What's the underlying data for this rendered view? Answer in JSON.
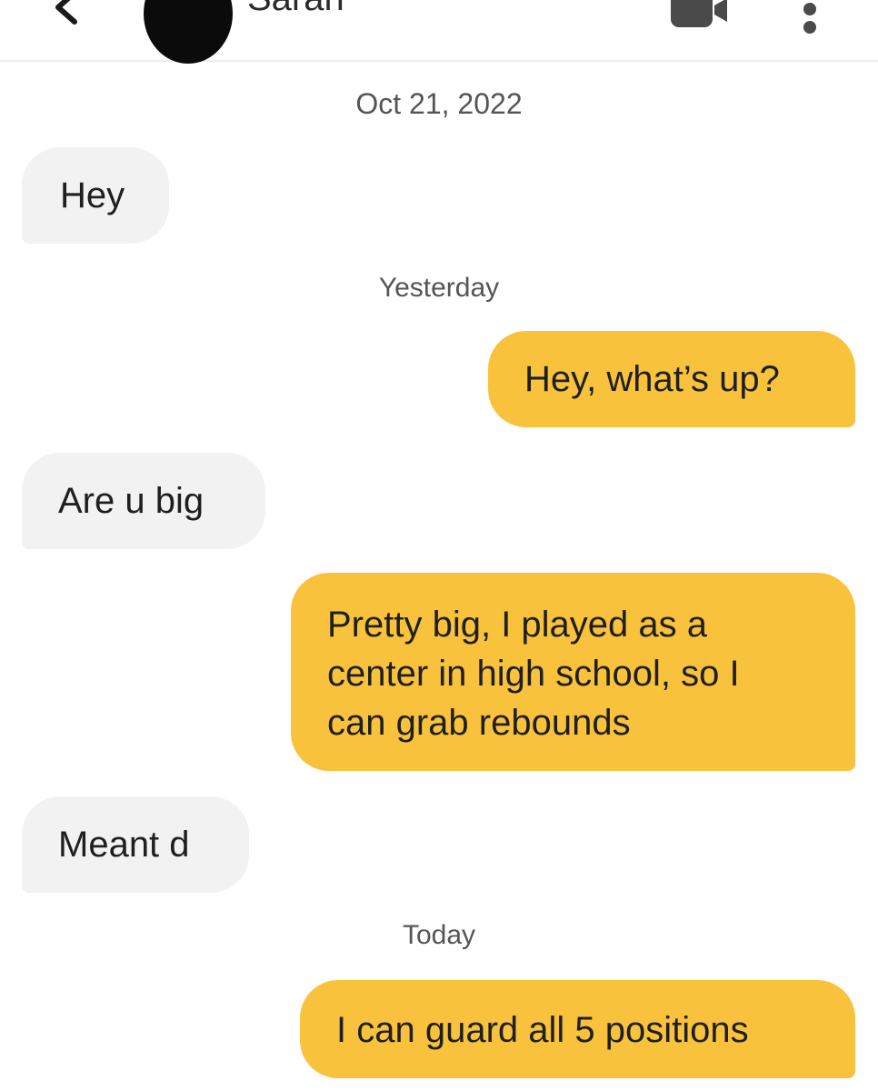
{
  "header": {
    "contact_name": "Sarah",
    "back_icon": "chevron-left-icon",
    "video_icon": "video-camera-icon",
    "more_icon": "more-vertical-icon"
  },
  "colors": {
    "outgoing_bubble": "#f9c23c",
    "incoming_bubble": "#f2f2f2",
    "timestamp_text": "#555555"
  },
  "conversation": {
    "date_1": "Oct 21, 2022",
    "date_2": "Yesterday",
    "date_3": "Today",
    "messages": [
      {
        "direction": "incoming",
        "text": "Hey"
      },
      {
        "direction": "outgoing",
        "text": "Hey, what’s up?"
      },
      {
        "direction": "incoming",
        "text": "Are u big"
      },
      {
        "direction": "outgoing",
        "lines": [
          "Pretty big, I played as a",
          "center in high school, so I",
          "can grab rebounds"
        ]
      },
      {
        "direction": "incoming",
        "text": "Meant d"
      },
      {
        "direction": "outgoing",
        "text": "I can guard all 5 positions"
      }
    ]
  }
}
